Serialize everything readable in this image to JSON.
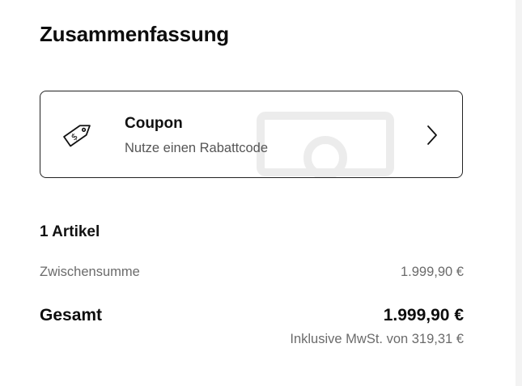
{
  "summary": {
    "title": "Zusammenfassung"
  },
  "coupon": {
    "title": "Coupon",
    "subtitle": "Nutze einen Rabattcode",
    "icon": "tag-icon",
    "action_icon": "chevron-right-icon"
  },
  "cart": {
    "item_count_label": "1 Artikel",
    "subtotal_label": "Zwischensumme",
    "subtotal_value": "1.999,90 €",
    "total_label": "Gesamt",
    "total_value": "1.999,90 €",
    "vat_note": "Inklusive MwSt. von 319,31 €"
  },
  "colors": {
    "text": "#111111",
    "muted": "#6b6b6b",
    "border": "#222222",
    "background": "#ffffff"
  }
}
